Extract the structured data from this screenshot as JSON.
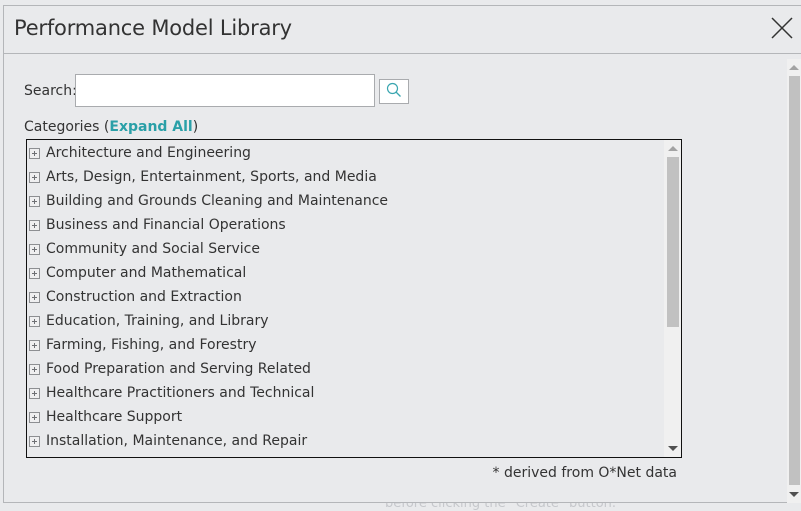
{
  "dialog": {
    "title": "Performance Model Library",
    "close_icon": "close-x-icon"
  },
  "search": {
    "label": "Search:",
    "value": "",
    "placeholder": "",
    "button_icon": "search-icon"
  },
  "categories": {
    "label_prefix": "Categories (",
    "expand_all": "Expand All",
    "label_suffix": ")",
    "items": [
      {
        "label": "Architecture and Engineering",
        "icon": "expand-plus-icon"
      },
      {
        "label": "Arts, Design, Entertainment, Sports, and Media",
        "icon": "expand-plus-icon"
      },
      {
        "label": "Building and Grounds Cleaning and Maintenance",
        "icon": "expand-plus-icon"
      },
      {
        "label": "Business and Financial Operations",
        "icon": "expand-plus-icon"
      },
      {
        "label": "Community and Social Service",
        "icon": "expand-plus-icon"
      },
      {
        "label": "Computer and Mathematical",
        "icon": "expand-plus-icon"
      },
      {
        "label": "Construction and Extraction",
        "icon": "expand-plus-icon"
      },
      {
        "label": "Education, Training, and Library",
        "icon": "expand-plus-icon"
      },
      {
        "label": "Farming, Fishing, and Forestry",
        "icon": "expand-plus-icon"
      },
      {
        "label": "Food Preparation and Serving Related",
        "icon": "expand-plus-icon"
      },
      {
        "label": "Healthcare Practitioners and Technical",
        "icon": "expand-plus-icon"
      },
      {
        "label": "Healthcare Support",
        "icon": "expand-plus-icon"
      },
      {
        "label": "Installation, Maintenance, and Repair",
        "icon": "expand-plus-icon"
      },
      {
        "label": "",
        "icon": "expand-plus-icon"
      }
    ],
    "scroll_position": 0
  },
  "footnote": "* derived from O*Net data",
  "colors": {
    "link": "#2aa0a8",
    "background": "#e9eaec",
    "border": "#b4b6b9"
  },
  "backdrop_text": "before clicking the \"Create\" button."
}
